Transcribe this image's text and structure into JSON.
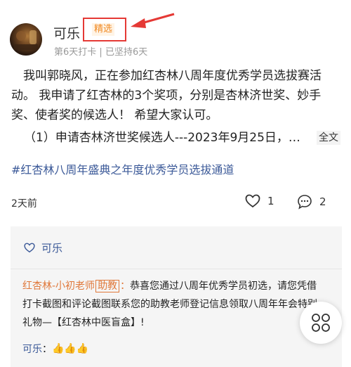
{
  "post": {
    "username": "可乐",
    "badge": "精选",
    "meta_days": "第6天打卡",
    "meta_separator": "|",
    "meta_persist": "已坚持6天",
    "paragraph1": "我叫郭晓风，正在参加红杏林八周年度优秀学员选拔赛活动。 我申请了红杏林的3个奖项，分别是杏林济世奖、妙手奖、使者奖的候选人！ 希望大家认可。",
    "paragraph2": "（1）申请杏林济世奖候选人---2023年9月25日，…",
    "full_text_label": "全文",
    "hashtag": "#红杏林八周年盛典之年度优秀学员选拔通道",
    "time": "2天前",
    "like_count": "1",
    "comment_count": "2"
  },
  "panel": {
    "liker": "可乐",
    "reply1": {
      "author": "红杏林-小初老师",
      "role": "助教",
      "colon": "：",
      "text": "恭喜您通过八周年优秀学员初选，请您凭借打卡截图和评论截图联系您的助教老师登记信息领取八周年年会特别礼物—【红杏林中医盲盒】!"
    },
    "reply2": {
      "author": "可乐",
      "colon": "：",
      "emoji": "👍👍👍"
    }
  },
  "icons": {
    "like": "heart-outline-icon",
    "comment": "comment-bubble-icon",
    "fab": "four-petal-menu-icon",
    "annotation": "red-arrow-icon"
  },
  "colors": {
    "badge_text": "#f08a24",
    "badge_bg": "#fff4e6",
    "annotation_red": "#e53935",
    "link_blue": "#3b5998",
    "teacher_orange": "#e0783a"
  }
}
